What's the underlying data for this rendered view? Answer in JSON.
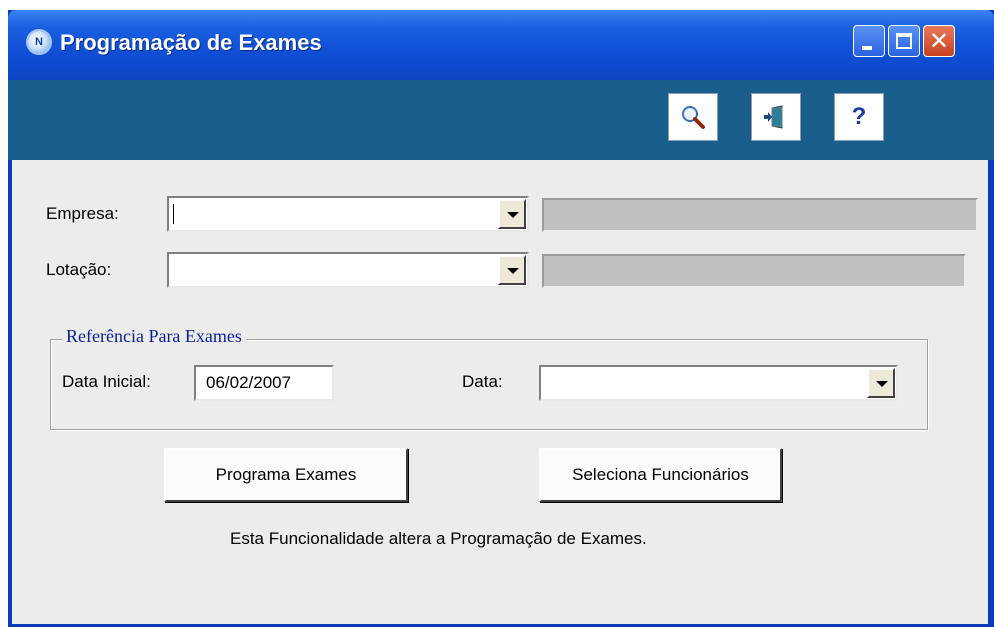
{
  "window": {
    "title": "Programação de Exames",
    "icon_letter": "N"
  },
  "titlebar_buttons": {
    "minimize": "minimize",
    "maximize": "maximize",
    "close": "✕"
  },
  "toolbar": {
    "search_icon": "magnifier-icon",
    "exit_icon": "exit-door-icon",
    "help_label": "?"
  },
  "form": {
    "empresa_label": "Empresa:",
    "empresa_value": "",
    "lotacao_label": "Lotação:",
    "lotacao_value": ""
  },
  "group": {
    "legend": "Referência Para Exames",
    "data_inicial_label": "Data Inicial:",
    "data_inicial_value": "06/02/2007",
    "data_label": "Data:",
    "data_value": ""
  },
  "actions": {
    "programa_label": "Programa Exames",
    "seleciona_label": "Seleciona Funcionários"
  },
  "info_text": "Esta Funcionalidade altera a Programação de Exames.",
  "colors": {
    "titlebar": "#1a5fe0",
    "toolbar": "#1a5e8e",
    "panel": "#ececea",
    "legend": "#0a1f9c"
  }
}
